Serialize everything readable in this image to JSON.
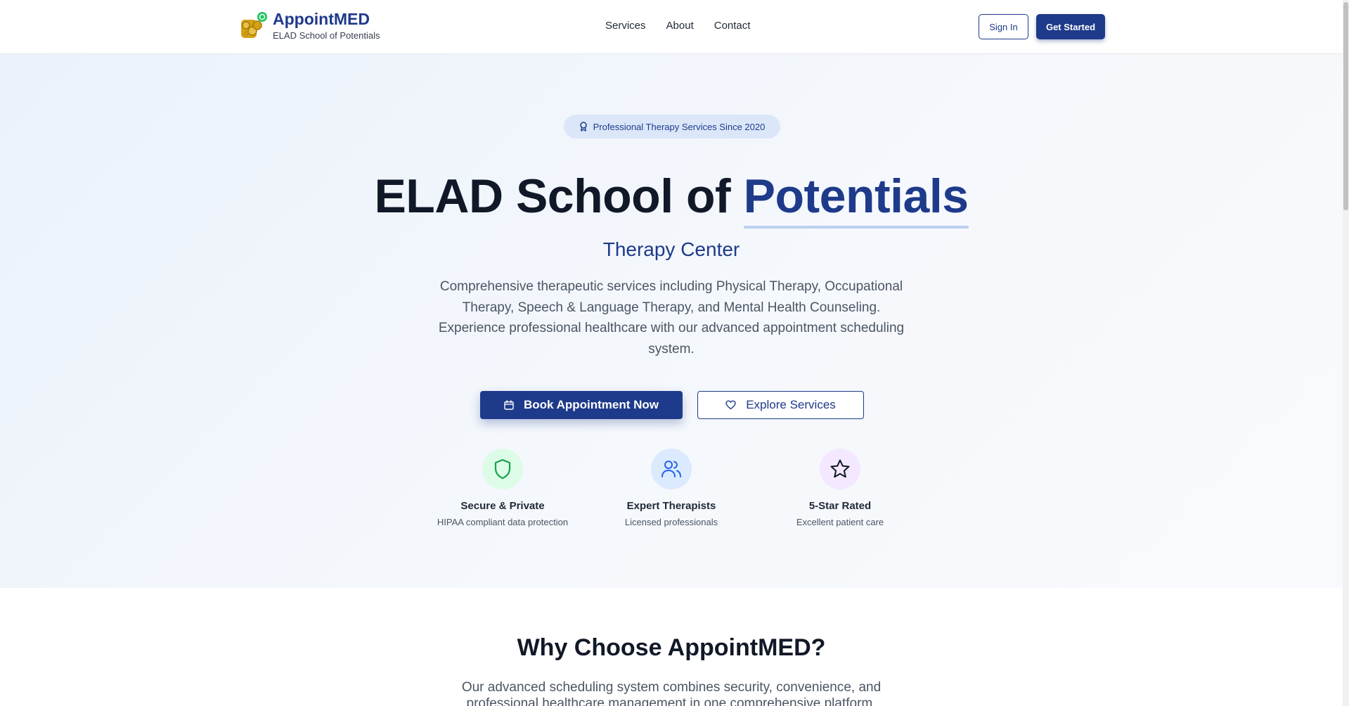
{
  "header": {
    "brand_name": "AppointMED",
    "brand_sub": "ELAD School of Potentials",
    "nav": [
      "Services",
      "About",
      "Contact"
    ],
    "sign_in": "Sign In",
    "get_started": "Get Started"
  },
  "hero": {
    "badge": "Professional Therapy Services Since 2020",
    "title_main": "ELAD School of ",
    "title_accent": "Potentials",
    "subtitle": "Therapy Center",
    "description": "Comprehensive therapeutic services including Physical Therapy, Occupational Therapy, Speech & Language Therapy, and Mental Health Counseling. Experience professional healthcare with our advanced appointment scheduling system.",
    "primary_button": "Book Appointment Now",
    "secondary_button": "Explore Services",
    "features": [
      {
        "title": "Secure & Private",
        "desc": "HIPAA compliant data protection",
        "icon": "shield-icon",
        "bg": "#dcfce7",
        "color": "#16a34a"
      },
      {
        "title": "Expert Therapists",
        "desc": "Licensed professionals",
        "icon": "users-icon",
        "bg": "#dbeafe",
        "color": "#2563eb"
      },
      {
        "title": "5-Star Rated",
        "desc": "Excellent patient care",
        "icon": "star-icon",
        "bg": "#f3e8ff",
        "color": "#111827"
      }
    ]
  },
  "why": {
    "title": "Why Choose AppointMED?",
    "description": "Our advanced scheduling system combines security, convenience, and professional healthcare management in one comprehensive platform."
  },
  "colors": {
    "brand": "#1e3a8a",
    "accent_underline": "#bcd0ee"
  }
}
